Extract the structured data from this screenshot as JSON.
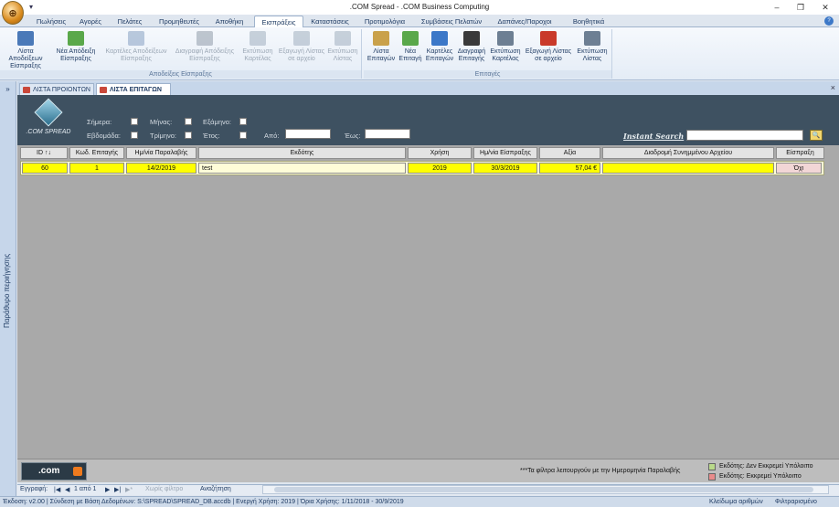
{
  "window": {
    "title": ".COM Spread - .COM Business Computing",
    "minimize": "–",
    "restore": "❐",
    "close": "✕"
  },
  "ribbon_tabs": [
    "Πωλήσεις",
    "Αγορές",
    "Πελάτες",
    "Προμηθευτές",
    "Αποθήκη",
    "Εισπράξεις",
    "Καταστάσεις",
    "Προτιμολόγια",
    "Συμβάσεις Πελατών",
    "Δαπάνες/Παροχοι",
    "Βοηθητικά"
  ],
  "active_tab": "Εισπράξεις",
  "ribbon_groups": [
    {
      "label": "Αποδείξεις Είσπραξης",
      "buttons": [
        {
          "label1": "Λίστα Αποδείξεων",
          "label2": "Είσπραξης",
          "icon": "receipt-list-icon",
          "color": "#4a79b8",
          "enabled": true
        },
        {
          "label1": "Νέα Απόδειξη",
          "label2": "Είσπραξης",
          "icon": "new-receipt-icon",
          "color": "#5aa84a",
          "enabled": true
        },
        {
          "label1": "Καρτέλες Αποδείξεων",
          "label2": "Είσπραξης",
          "icon": "cards-icon",
          "color": "#6f8fb5",
          "enabled": false
        },
        {
          "label1": "Διαγραφή Απόδειξης",
          "label2": "Είσπραξης",
          "icon": "trash-icon",
          "color": "#7a8896",
          "enabled": false
        },
        {
          "label1": "Εκτύπωση",
          "label2": "Καρτέλας",
          "icon": "print-card-icon",
          "color": "#8fa0b2",
          "enabled": false
        },
        {
          "label1": "Εξαγωγή Λίστας",
          "label2": "σε αρχείο",
          "icon": "export-icon",
          "color": "#8fa0b2",
          "enabled": false
        },
        {
          "label1": "Εκτύπωση",
          "label2": "Λίστας",
          "icon": "print-list-icon",
          "color": "#8fa0b2",
          "enabled": false
        }
      ]
    },
    {
      "label": "Επιταγές",
      "buttons": [
        {
          "label1": "Λίστα",
          "label2": "Επιταγών",
          "icon": "cheque-list-icon",
          "color": "#c9a14a",
          "enabled": true
        },
        {
          "label1": "Νέα",
          "label2": "Επιταγή",
          "icon": "new-cheque-icon",
          "color": "#5aa84a",
          "enabled": true
        },
        {
          "label1": "Καρτέλες",
          "label2": "Επιταγών",
          "icon": "cheque-cards-icon",
          "color": "#3c78c8",
          "enabled": true
        },
        {
          "label1": "Διαγραφή",
          "label2": "Επιταγής",
          "icon": "trash-icon",
          "color": "#3a3a3a",
          "enabled": true
        },
        {
          "label1": "Εκτύπωση",
          "label2": "Καρτέλας",
          "icon": "print-card-icon",
          "color": "#6d7f93",
          "enabled": true
        },
        {
          "label1": "Εξαγωγή Λίστας",
          "label2": "σε αρχείο",
          "icon": "export-icon",
          "color": "#c93a2a",
          "enabled": true
        },
        {
          "label1": "Εκτύπωση",
          "label2": "Λίστας",
          "icon": "print-list-icon",
          "color": "#6d7f93",
          "enabled": true
        }
      ]
    }
  ],
  "nav_pane": {
    "chevron": "»",
    "label": "Παράθυρο περιήγησης"
  },
  "doc_tabs": [
    {
      "label": "ΛΙΣΤΑ ΠΡΟΙΟΝΤΩΝ",
      "active": false
    },
    {
      "label": "ΛΙΣΤΑ ΕΠΙΤΑΓΩΝ",
      "active": true
    }
  ],
  "doc_close": "×",
  "filters": {
    "logo_text": ".COM SPREAD",
    "today": "Σήμερα:",
    "week": "Εβδομάδα:",
    "month": "Μήνας:",
    "quarter": "Τρίμηνο:",
    "semester": "Εξάμηνο:",
    "year": "Έτος:",
    "from": "Από:",
    "to": "Έως:",
    "from_value": "",
    "to_value": ""
  },
  "instant_search": {
    "label": "Instant Search",
    "value": "",
    "button": "🔍"
  },
  "grid": {
    "columns": [
      "ID ↑↓",
      "Κωδ. Επιταγής",
      "Ημ/νία Παραλαβής",
      "Εκδότης",
      "Χρήση",
      "Ημ/νία Είσπραξης",
      "Αξία",
      "Διαδρομή Συνημμένου Αρχείου",
      "Είσπραξη"
    ],
    "rows": [
      [
        "60",
        "1",
        "14/2/2019",
        "test",
        "2019",
        "30/3/2019",
        "57,04 €",
        "",
        "Όχι"
      ]
    ]
  },
  "footer": {
    "logo_text": ".com",
    "note": "***Τα φίλτρα λειτουργούν με την Ημερομηνία Παραλαβής",
    "legend": [
      {
        "label": "Εκδότης: Δεν Εκκρεμεί Υπόλοιπο",
        "color": "#b9d98a"
      },
      {
        "label": "Εκδότης: Εκκρεμεί Υπόλοιπο",
        "color": "#e88b8b"
      }
    ]
  },
  "record_nav": {
    "label": "Εγγραφή:",
    "first": "|◀",
    "prev": "◀",
    "position": "1 από 1",
    "next": "▶",
    "last": "▶|",
    "new": "▶*",
    "filter": "Χωρίς φίλτρο",
    "search": "Αναζήτηση"
  },
  "status": {
    "left": "Έκδοση: v2.00 | Σύνδεση με Βάση Δεδομένων: S:\\SPREAD\\SPREAD_DB.accdb  |  Ενεργή Χρήση: 2019  |  Όρια Χρήσης: 1/11/2018 - 30/9/2019",
    "numlock": "Κλείδωμα αριθμών",
    "filtered": "Φιλτραρισμένο"
  },
  "colors": {
    "header_dark": "#3e5161",
    "row_highlight": "#ffff00",
    "grid_bg": "#a9a9a9"
  }
}
